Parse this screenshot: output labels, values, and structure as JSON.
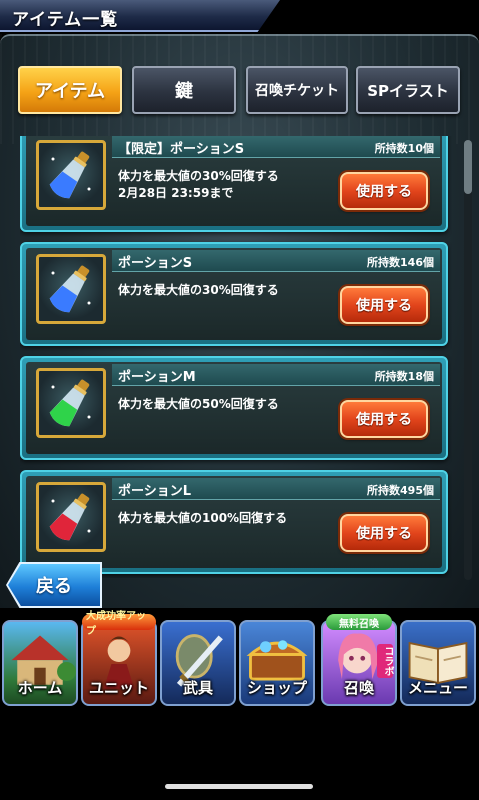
{
  "header": {
    "title": "アイテム一覧"
  },
  "tabs": [
    {
      "label": "アイテム",
      "active": true
    },
    {
      "label": "鍵",
      "active": false
    },
    {
      "label": "召喚チケット",
      "active": false
    },
    {
      "label": "SPイラスト",
      "active": false
    }
  ],
  "items": [
    {
      "name": "【限定】ポーションS",
      "count": "所持数10個",
      "desc1": "体力を最大値の30%回復する",
      "desc2": "2月28日 23:59まで",
      "button": "使用する",
      "potion_color": "#3a7bff"
    },
    {
      "name": "ポーションS",
      "count": "所持数146個",
      "desc1": "体力を最大値の30%回復する",
      "desc2": "",
      "button": "使用する",
      "potion_color": "#3a7bff"
    },
    {
      "name": "ポーションM",
      "count": "所持数18個",
      "desc1": "体力を最大値の50%回復する",
      "desc2": "",
      "button": "使用する",
      "potion_color": "#2fd34a"
    },
    {
      "name": "ポーションL",
      "count": "所持数495個",
      "desc1": "体力を最大値の100%回復する",
      "desc2": "",
      "button": "使用する",
      "potion_color": "#e0253a"
    }
  ],
  "back_button": {
    "label": "戻る"
  },
  "nav": [
    {
      "label": "ホーム",
      "badge": "",
      "icon": "house-icon"
    },
    {
      "label": "ユニット",
      "badge": "大成功率アップ",
      "icon": "unit-hero-icon"
    },
    {
      "label": "武具",
      "badge": "",
      "icon": "sword-icon"
    },
    {
      "label": "ショップ",
      "badge": "",
      "icon": "treasure-chest-icon"
    },
    {
      "label": "召喚",
      "badge": "無料召喚",
      "side_badge": "コラボ",
      "icon": "summon-character-icon"
    },
    {
      "label": "メニュー",
      "badge": "",
      "icon": "book-icon"
    }
  ]
}
